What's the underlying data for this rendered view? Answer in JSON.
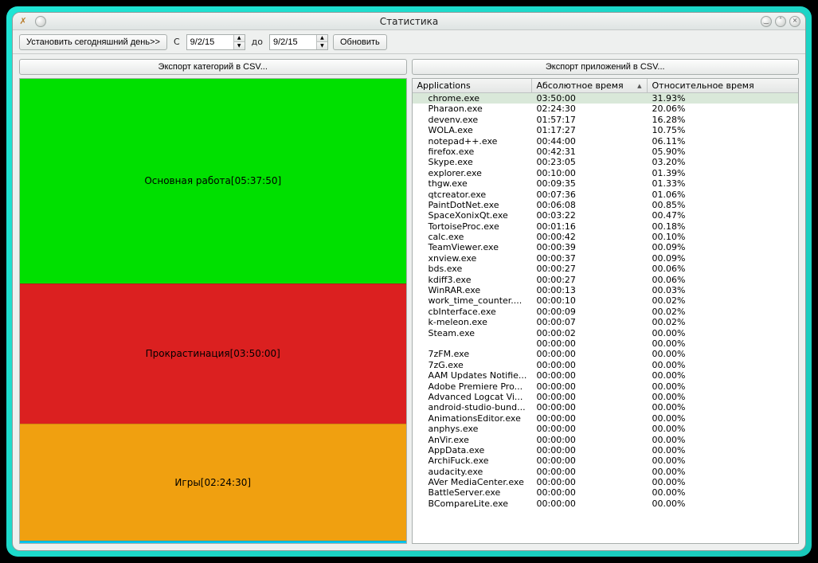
{
  "window": {
    "title": "Статистика"
  },
  "toolbar": {
    "set_today": "Установить сегодняшний день>>",
    "from_label": "С",
    "from_value": "9/2/15",
    "to_label": "до",
    "to_value": "9/2/15",
    "refresh": "Обновить"
  },
  "export": {
    "categories": "Экспорт категорий в CSV...",
    "apps": "Экспорт приложений в CSV..."
  },
  "treemap": {
    "blocks": [
      {
        "label": "Основная работа[05:37:50]",
        "color": "#00e000",
        "weight": 44
      },
      {
        "label": "Прокрастинация[03:50:00]",
        "color": "#db2020",
        "weight": 30
      },
      {
        "label": "Игры[02:24:30]",
        "color": "#f0a010",
        "weight": 25
      }
    ],
    "sliver_color": "#06c8f0"
  },
  "table": {
    "headers": {
      "app": "Applications",
      "abs": "Абсолютное время",
      "rel": "Относительное время"
    },
    "sort_indicator": "▲",
    "rows": [
      {
        "app": "chrome.exe",
        "abs": "03:50:00",
        "rel": "31.93%",
        "selected": true
      },
      {
        "app": "Pharaon.exe",
        "abs": "02:24:30",
        "rel": "20.06%"
      },
      {
        "app": "devenv.exe",
        "abs": "01:57:17",
        "rel": "16.28%"
      },
      {
        "app": "WOLA.exe",
        "abs": "01:17:27",
        "rel": "10.75%"
      },
      {
        "app": "notepad++.exe",
        "abs": "00:44:00",
        "rel": "06.11%"
      },
      {
        "app": "firefox.exe",
        "abs": "00:42:31",
        "rel": "05.90%"
      },
      {
        "app": "Skype.exe",
        "abs": "00:23:05",
        "rel": "03.20%"
      },
      {
        "app": "explorer.exe",
        "abs": "00:10:00",
        "rel": "01.39%"
      },
      {
        "app": "thgw.exe",
        "abs": "00:09:35",
        "rel": "01.33%"
      },
      {
        "app": "qtcreator.exe",
        "abs": "00:07:36",
        "rel": "01.06%"
      },
      {
        "app": "PaintDotNet.exe",
        "abs": "00:06:08",
        "rel": "00.85%"
      },
      {
        "app": "SpaceXonixQt.exe",
        "abs": "00:03:22",
        "rel": "00.47%"
      },
      {
        "app": "TortoiseProc.exe",
        "abs": "00:01:16",
        "rel": "00.18%"
      },
      {
        "app": "calc.exe",
        "abs": "00:00:42",
        "rel": "00.10%"
      },
      {
        "app": "TeamViewer.exe",
        "abs": "00:00:39",
        "rel": "00.09%"
      },
      {
        "app": "xnview.exe",
        "abs": "00:00:37",
        "rel": "00.09%"
      },
      {
        "app": "bds.exe",
        "abs": "00:00:27",
        "rel": "00.06%"
      },
      {
        "app": "kdiff3.exe",
        "abs": "00:00:27",
        "rel": "00.06%"
      },
      {
        "app": "WinRAR.exe",
        "abs": "00:00:13",
        "rel": "00.03%"
      },
      {
        "app": "work_time_counter....",
        "abs": "00:00:10",
        "rel": "00.02%"
      },
      {
        "app": "cbInterface.exe",
        "abs": "00:00:09",
        "rel": "00.02%"
      },
      {
        "app": "k-meleon.exe",
        "abs": "00:00:07",
        "rel": "00.02%"
      },
      {
        "app": "Steam.exe",
        "abs": "00:00:02",
        "rel": "00.00%"
      },
      {
        "app": "",
        "abs": "00:00:00",
        "rel": "00.00%"
      },
      {
        "app": "7zFM.exe",
        "abs": "00:00:00",
        "rel": "00.00%"
      },
      {
        "app": "7zG.exe",
        "abs": "00:00:00",
        "rel": "00.00%"
      },
      {
        "app": "AAM Updates Notifie...",
        "abs": "00:00:00",
        "rel": "00.00%"
      },
      {
        "app": "Adobe Premiere Pro...",
        "abs": "00:00:00",
        "rel": "00.00%"
      },
      {
        "app": "Advanced Logcat Vi...",
        "abs": "00:00:00",
        "rel": "00.00%"
      },
      {
        "app": "android-studio-bund...",
        "abs": "00:00:00",
        "rel": "00.00%"
      },
      {
        "app": "AnimationsEditor.exe",
        "abs": "00:00:00",
        "rel": "00.00%"
      },
      {
        "app": "anphys.exe",
        "abs": "00:00:00",
        "rel": "00.00%"
      },
      {
        "app": "AnVir.exe",
        "abs": "00:00:00",
        "rel": "00.00%"
      },
      {
        "app": "AppData.exe",
        "abs": "00:00:00",
        "rel": "00.00%"
      },
      {
        "app": "ArchiFuck.exe",
        "abs": "00:00:00",
        "rel": "00.00%"
      },
      {
        "app": "audacity.exe",
        "abs": "00:00:00",
        "rel": "00.00%"
      },
      {
        "app": "AVer MediaCenter.exe",
        "abs": "00:00:00",
        "rel": "00.00%"
      },
      {
        "app": "BattleServer.exe",
        "abs": "00:00:00",
        "rel": "00.00%"
      },
      {
        "app": "BCompareLite.exe",
        "abs": "00:00:00",
        "rel": "00.00%"
      }
    ]
  }
}
